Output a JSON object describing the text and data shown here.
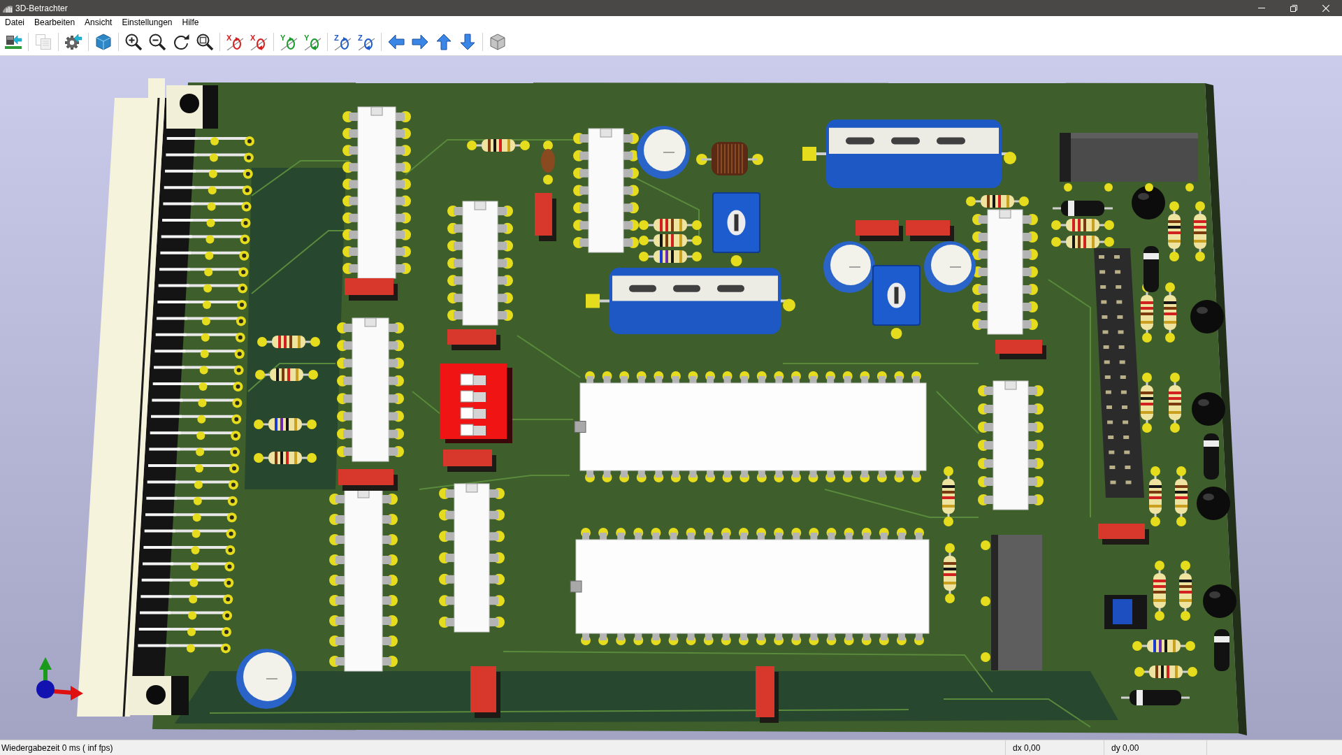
{
  "window": {
    "title": "3D-Betrachter"
  },
  "menu": [
    "Datei",
    "Bearbeiten",
    "Ansicht",
    "Einstellungen",
    "Hilfe"
  ],
  "toolbar": {
    "groups": [
      [
        {
          "kind": "reload",
          "disabled": false
        }
      ],
      [
        {
          "kind": "copy",
          "disabled": true
        }
      ],
      [
        {
          "kind": "settings",
          "disabled": false
        }
      ],
      [
        {
          "kind": "raytrace",
          "disabled": false
        }
      ],
      [
        {
          "kind": "zoomin",
          "disabled": false
        },
        {
          "kind": "zoomout",
          "disabled": false
        },
        {
          "kind": "redraw",
          "disabled": false
        },
        {
          "kind": "zoomfit",
          "disabled": false
        }
      ],
      [
        {
          "kind": "rotate",
          "axis": "X",
          "color": "#d42020",
          "reverse": false,
          "disabled": false
        },
        {
          "kind": "rotate",
          "axis": "X",
          "color": "#d42020",
          "reverse": true,
          "disabled": false
        }
      ],
      [
        {
          "kind": "rotate",
          "axis": "Y",
          "color": "#1a9a2a",
          "reverse": false,
          "disabled": false
        },
        {
          "kind": "rotate",
          "axis": "Y",
          "color": "#1a9a2a",
          "reverse": true,
          "disabled": false
        }
      ],
      [
        {
          "kind": "rotate",
          "axis": "Z",
          "color": "#1e5ac8",
          "reverse": false,
          "disabled": false
        },
        {
          "kind": "rotate",
          "axis": "Z",
          "color": "#1e5ac8",
          "reverse": true,
          "disabled": false
        }
      ],
      [
        {
          "kind": "left",
          "disabled": false
        },
        {
          "kind": "right",
          "disabled": false
        },
        {
          "kind": "up",
          "disabled": false
        },
        {
          "kind": "down",
          "disabled": false
        }
      ],
      [
        {
          "kind": "box",
          "disabled": false
        }
      ]
    ]
  },
  "board": {
    "dip_switch": {
      "switches": [
        {
          "on": false
        },
        {
          "on": false
        },
        {
          "on": false
        },
        {
          "on": false
        }
      ]
    }
  },
  "status_bar": {
    "render_time": "Wiedergabezeit 0 ms ( inf fps)",
    "dx": "dx 0,00",
    "dy": "dy 0,00"
  }
}
